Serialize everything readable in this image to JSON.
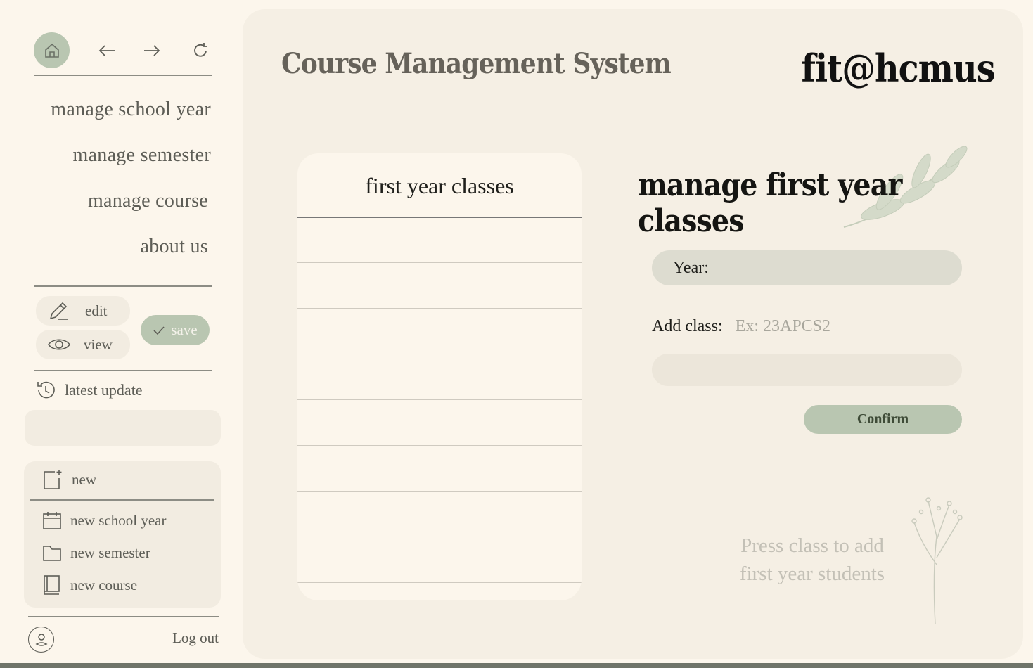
{
  "sidebar": {
    "menu": [
      {
        "label": "manage school year"
      },
      {
        "label": "manage semester"
      },
      {
        "label": "manage course"
      },
      {
        "label": "about us"
      }
    ],
    "edit_label": "edit",
    "view_label": "view",
    "save_label": "save",
    "latest_update_label": "latest update",
    "new_label": "new",
    "new_items": [
      {
        "label": "new school year"
      },
      {
        "label": "new semester"
      },
      {
        "label": "new course"
      }
    ],
    "logout_label": "Log out"
  },
  "header": {
    "app_title": "Course Management System",
    "brand": "fit@hcmus"
  },
  "class_list": {
    "title": "first year classes",
    "rows": [
      "",
      "",
      "",
      "",
      "",
      "",
      "",
      ""
    ]
  },
  "form": {
    "title": "manage first year classes",
    "year_label": "Year:",
    "add_class_label": "Add class:",
    "add_class_placeholder": "Ex: 23APCS2",
    "confirm_label": "Confirm",
    "hint_line1": "Press class to add",
    "hint_line2": "first year students"
  },
  "colors": {
    "accent": "#b9c6b1",
    "background": "#fcf6ec",
    "panel": "#f5efe4"
  }
}
